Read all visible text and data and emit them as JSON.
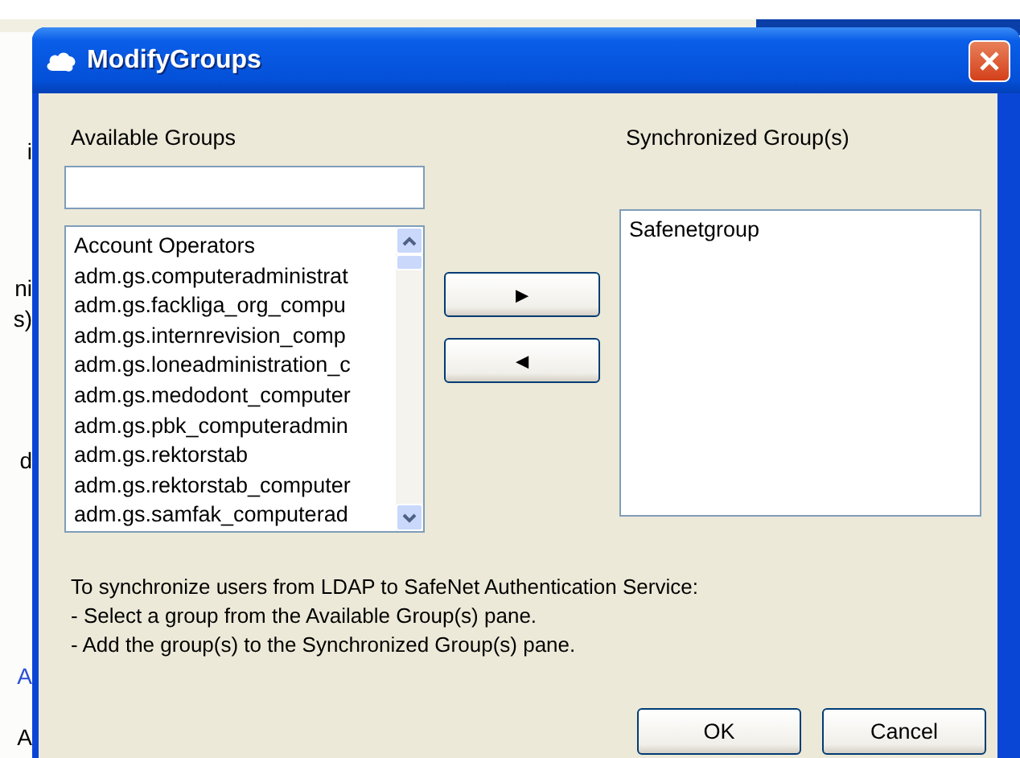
{
  "background_window": {
    "fragments": [
      {
        "text": "i",
        "link": false
      },
      {
        "text": "ni",
        "link": false
      },
      {
        "text": "s)",
        "link": false
      },
      {
        "text": "d",
        "link": false
      },
      {
        "text": "A",
        "link": true
      },
      {
        "text": "A",
        "link": false
      }
    ]
  },
  "window": {
    "title": "ModifyGroups"
  },
  "available": {
    "label": "Available Groups",
    "items": [
      "Account Operators",
      "adm.gs.computeradministrat",
      "adm.gs.fackliga_org_compu",
      "adm.gs.internrevision_comp",
      "adm.gs.loneadministration_c",
      "adm.gs.medodont_computer",
      "adm.gs.pbk_computeradmin",
      "adm.gs.rektorstab",
      "adm.gs.rektorstab_computer",
      "adm.gs.samfak_computerad"
    ]
  },
  "move_buttons": [
    "►",
    "◄"
  ],
  "synchronized": {
    "label": "Synchronized Group(s)",
    "items": [
      "Safenetgroup"
    ]
  },
  "instructions": [
    "To synchronize users from LDAP to SafeNet Authentication Service:",
    "- Select a group from the Available Group(s) pane.",
    "- Add the group(s) to the Synchronized Group(s) pane."
  ],
  "buttons": [
    "OK",
    "Cancel"
  ]
}
